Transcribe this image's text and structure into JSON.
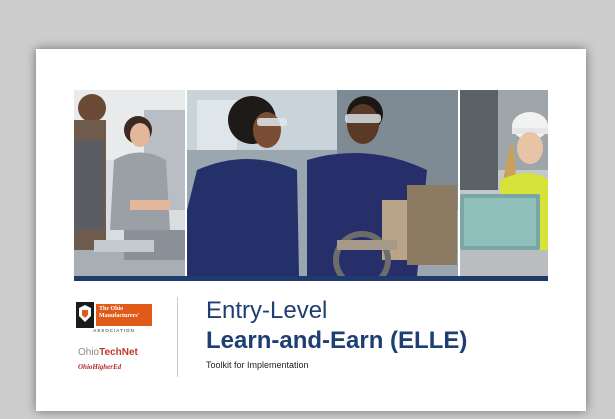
{
  "cover": {
    "title_line1": "Entry-Level",
    "title_line2": "Learn-and-Earn (ELLE)",
    "subtitle": "Toolkit for Implementation"
  },
  "logos": {
    "oma_line1": "The Ohio",
    "oma_line2": "Manufacturers'",
    "oma_sub": "ASSOCIATION",
    "ohiotechnet_prefix": "Ohio",
    "ohiotechnet_suffix": "TechNet",
    "ohiohighered": "OhioHigherEd"
  },
  "colors": {
    "title": "#1e3f73",
    "accent_bar": "#1f3a6b",
    "oma_orange": "#e05a1a"
  }
}
